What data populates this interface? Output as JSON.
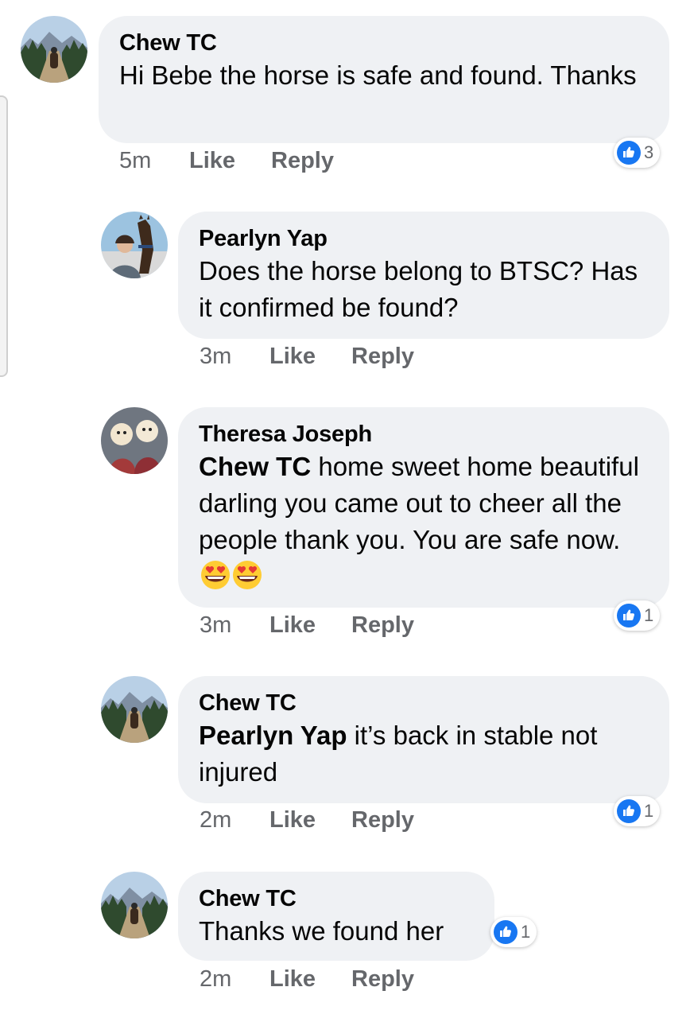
{
  "comments": [
    {
      "author": "Chew TC",
      "mention": "",
      "text": "Hi Bebe the horse is safe and found. Thanks",
      "time": "5m",
      "like": "Like",
      "reply": "Reply",
      "reactions": "3"
    },
    {
      "author": "Pearlyn Yap",
      "mention": "",
      "text": "Does the horse belong to BTSC? Has it confirmed be found?",
      "time": "3m",
      "like": "Like",
      "reply": "Reply",
      "reactions": ""
    },
    {
      "author": "Theresa Joseph",
      "mention": "Chew TC",
      "text": " home sweet home beautiful darling you came out to cheer all the people thank you. You are safe now.",
      "time": "3m",
      "like": "Like",
      "reply": "Reply",
      "reactions": "1"
    },
    {
      "author": "Chew TC",
      "mention": "Pearlyn Yap",
      "text": " it’s back in stable not injured",
      "time": "2m",
      "like": "Like",
      "reply": "Reply",
      "reactions": "1"
    },
    {
      "author": "Chew TC",
      "mention": "",
      "text": "Thanks we found her",
      "time": "2m",
      "like": "Like",
      "reply": "Reply",
      "reactions": "1"
    }
  ],
  "icons": {
    "reaction": "like-thumb-icon",
    "emoji": "heart-eyes-emoji-icon"
  },
  "colors": {
    "bubble": "#eff1f4",
    "like_blue": "#1877f2",
    "meta_gray": "#65676b"
  }
}
